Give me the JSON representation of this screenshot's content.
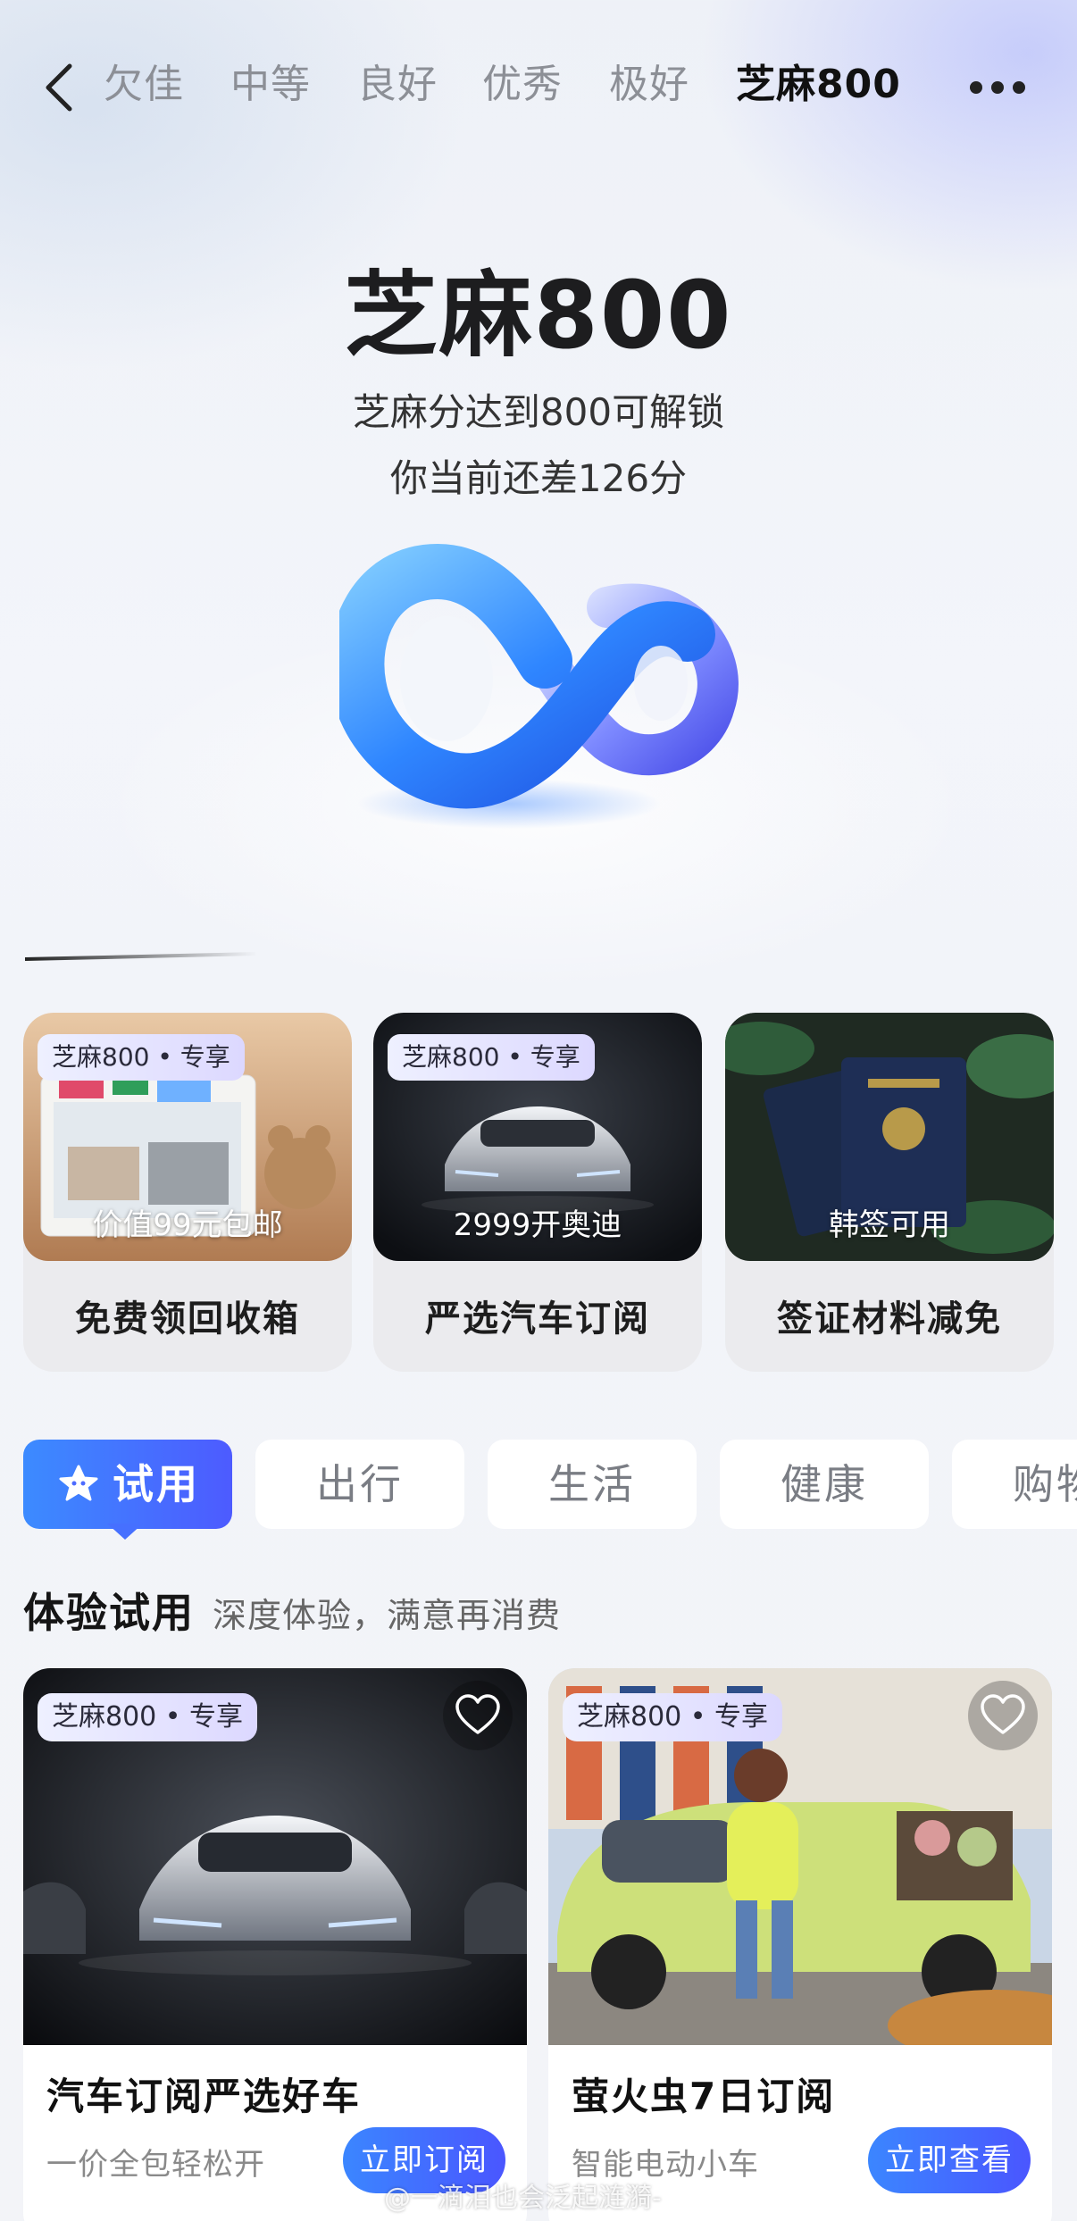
{
  "nav": {
    "levels": [
      "欠佳",
      "中等",
      "良好",
      "优秀",
      "极好",
      "芝麻800"
    ],
    "active_level": "芝麻800"
  },
  "hero": {
    "title": "芝麻800",
    "subtitle_line1": "芝麻分达到800可解锁",
    "subtitle_line2": "你当前还差126分"
  },
  "benefits": [
    {
      "tag": "芝麻800 • 专享",
      "caption": "价值99元包邮",
      "title": "免费领回收箱"
    },
    {
      "tag": "芝麻800 • 专享",
      "caption": "2999开奥迪",
      "title": "严选汽车订阅"
    },
    {
      "tag": "",
      "caption": "韩签可用",
      "title": "签证材料减免"
    }
  ],
  "categories": [
    "试用",
    "出行",
    "生活",
    "健康",
    "购物"
  ],
  "active_category": "试用",
  "section": {
    "title": "体验试用",
    "subtitle": "深度体验，满意再消费"
  },
  "products": [
    {
      "tag": "芝麻800 • 专享",
      "title": "汽车订阅严选好车",
      "desc": "一价全包轻松开",
      "button": "立即订阅"
    },
    {
      "tag": "芝麻800 • 专享",
      "title": "萤火虫7日订阅",
      "desc": "智能电动小车",
      "button": "立即查看"
    }
  ],
  "watermark": "@一滴泪也会泛起涟漪-",
  "colors": {
    "accent_blue": "#3c8bff",
    "accent_indigo": "#4d5bff",
    "tag_bg": "#e3e2ff"
  }
}
